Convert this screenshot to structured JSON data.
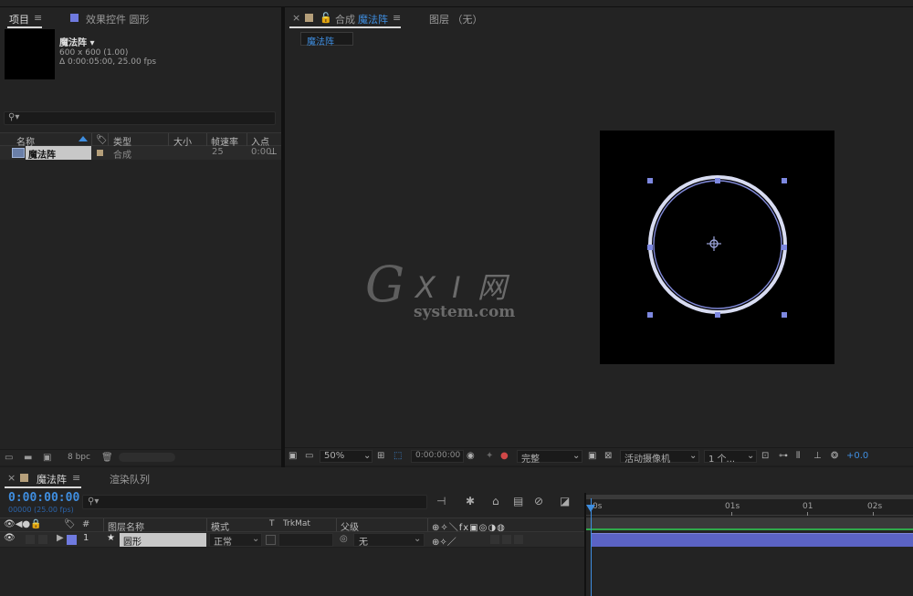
{
  "project_panel": {
    "tab_project": "项目",
    "tab_effects": "效果控件 圆形",
    "menu_glyph": "≡",
    "comp_name": "魔法阵 ▾",
    "comp_size": "600 x 600 (1.00)",
    "comp_duration": "Δ 0:00:05:00, 25.00 fps",
    "search_icon": "⚲▾",
    "columns": {
      "name": "名称",
      "type": "类型",
      "size": "大小",
      "fps": "帧速率",
      "in": "入点"
    },
    "row": {
      "name": "魔法阵",
      "type": "合成",
      "fps": "25",
      "in": "0:00"
    },
    "bpc": "8 bpc",
    "label_color": "#b59f7a"
  },
  "comp_panel": {
    "tab_label": "合成",
    "tab_name": "魔法阵",
    "layer_tab": "图层 （无）",
    "subtab": "魔法阵",
    "watermark_big": "G",
    "watermark_mid": "X I 网",
    "watermark_small": "system.com",
    "toolbar": {
      "zoom": "50%",
      "timecode": "0:00:00:00",
      "resolution": "完整",
      "camera": "活动摄像机",
      "views": "1 个...",
      "exposure": "+0.0"
    },
    "accent": "#3f8ee0",
    "handle_color": "#7d88e0"
  },
  "timeline": {
    "tab_comp": "魔法阵",
    "tab_render": "渲染队列",
    "menu_glyph": "≡",
    "timecode": "0:00:00:00",
    "sub_timecode": "00000 (25.00 fps)",
    "columns": {
      "source": "图层名称",
      "mode": "模式",
      "t": "T",
      "trkmat": "TrkMat",
      "parent": "父级",
      "num": "#"
    },
    "layer": {
      "num": "1",
      "name": "圆形",
      "mode": "正常",
      "parent": "无",
      "label_color": "#6f7adf"
    },
    "ruler": [
      "0s",
      "01s",
      "01",
      "02s"
    ],
    "bar_color": "#5b63c4",
    "work_color": "#2fa84a"
  }
}
